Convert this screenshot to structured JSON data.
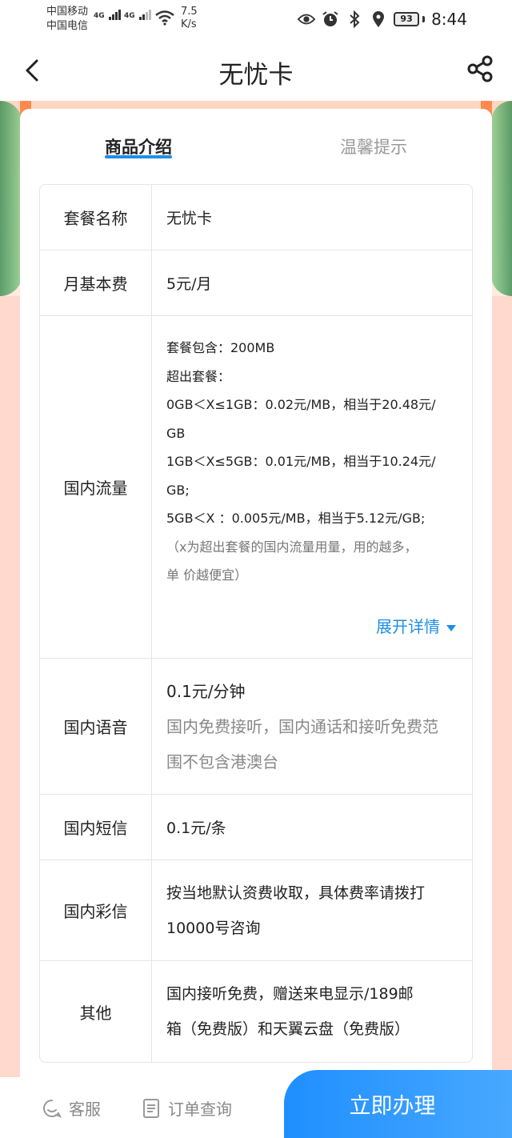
{
  "status_bar": {
    "carrier1": "中国移动",
    "carrier2": "中国电信",
    "network1": "4G",
    "network2": "4G",
    "speed_value": "7.5",
    "speed_unit": "K/s",
    "battery": "93",
    "time": "8:44"
  },
  "nav": {
    "title": "无忧卡"
  },
  "tabs": [
    {
      "label": "商品介绍",
      "active": true
    },
    {
      "label": "温馨提示",
      "active": false
    }
  ],
  "table": {
    "plan_name": {
      "key": "套餐名称",
      "value": "无忧卡"
    },
    "monthly_fee": {
      "key": "月基本费",
      "value": "5元/月"
    },
    "domestic_data": {
      "key": "国内流量",
      "lines": [
        "套餐包含：200MB",
        "超出套餐：",
        "0GB＜X≤1GB：0.02元/MB，相当于20.48元/",
        "GB",
        "1GB＜X≤5GB：0.01元/MB，相当于10.24元/",
        "GB;",
        "5GB＜X ：0.005元/MB，相当于5.12元/GB;"
      ],
      "note_lines": [
        "（x为超出套餐的国内流量用量，用的越多，",
        "单 价越便宜）"
      ],
      "expand_label": "展开详情"
    },
    "domestic_voice": {
      "key": "国内语音",
      "value": "0.1元/分钟",
      "note_lines": [
        "国内免费接听，国内通话和接听免费范",
        "围不包含港澳台"
      ]
    },
    "domestic_sms": {
      "key": "国内短信",
      "value": "0.1元/条"
    },
    "domestic_mms": {
      "key": "国内彩信",
      "value_lines": [
        "按当地默认资费收取，具体费率请拨打",
        "10000号咨询"
      ]
    },
    "other": {
      "key": "其他",
      "value_lines": [
        "国内接听免费，赠送来电显示/189邮",
        "箱（免费版）和天翼云盘（免费版）"
      ]
    }
  },
  "bottom_bar": {
    "service_label": "客服",
    "order_label": "订单查询",
    "cta_label": "立即办理"
  },
  "colors": {
    "accent": "#1f8fe5",
    "cta": "#2e96ff",
    "page_bg": "#ffd9cd"
  }
}
